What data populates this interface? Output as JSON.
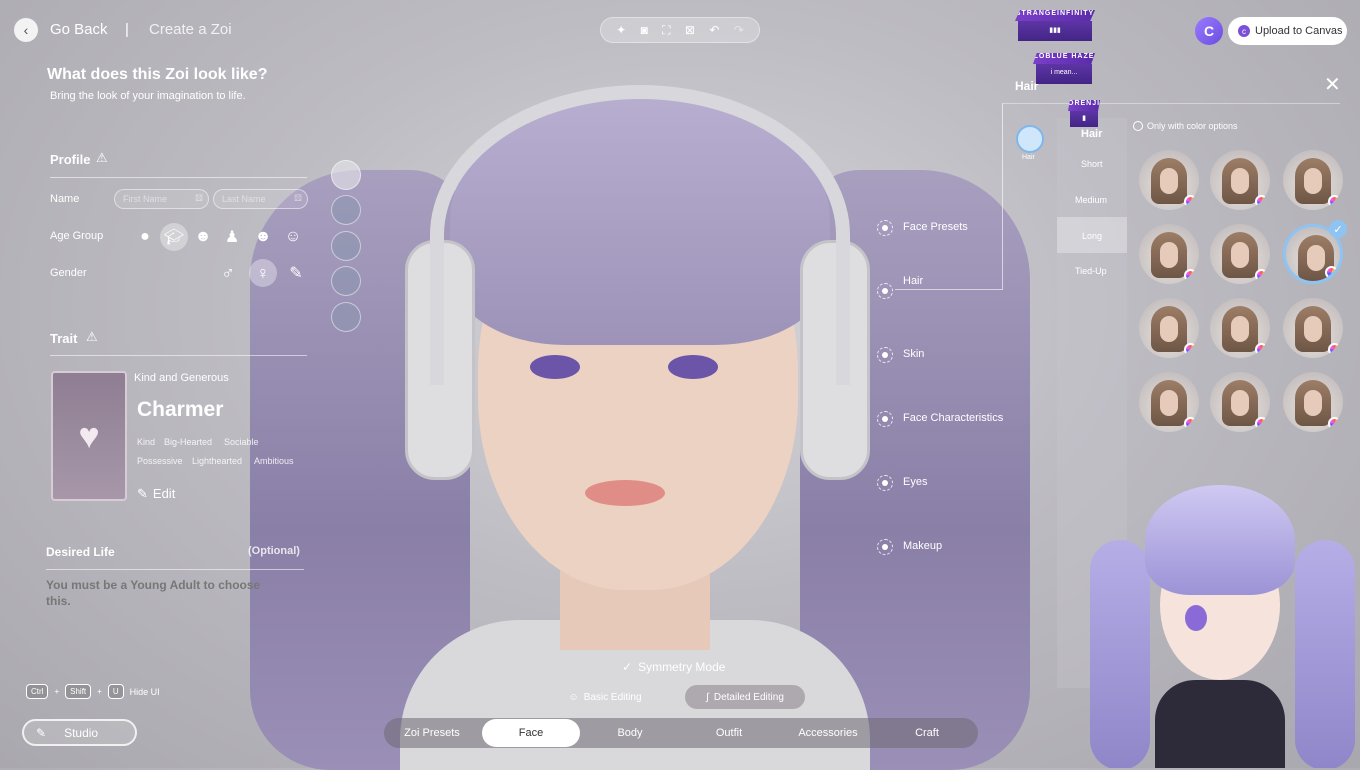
{
  "header": {
    "back_label": "Go Back",
    "separator": "|",
    "title": "Create a Zoi",
    "upload_label": "Upload to Canvas"
  },
  "intro": {
    "heading": "What does this Zoi look like?",
    "subheading": "Bring the look of your imagination to life."
  },
  "profile": {
    "title": "Profile",
    "name_label": "Name",
    "first_name_placeholder": "First Name",
    "last_name_placeholder": "Last Name",
    "age_label": "Age Group",
    "gender_label": "Gender",
    "male_symbol": "♂",
    "female_symbol": "♀"
  },
  "trait": {
    "title": "Trait",
    "subtitle": "Kind and Generous",
    "name": "Charmer",
    "tags": [
      "Kind",
      "Big-Hearted",
      "Sociable",
      "Possessive",
      "Lighthearted",
      "Ambitious"
    ],
    "edit_label": "Edit"
  },
  "desired_life": {
    "title": "Desired Life",
    "optional": "(Optional)",
    "message": "You must be a Young Adult to choose this."
  },
  "shortcut": {
    "keys": [
      "Ctrl",
      "Shift",
      "U"
    ],
    "plus": "+",
    "label": "Hide UI"
  },
  "studio_label": "Studio",
  "categories": [
    "Face Presets",
    "Hair",
    "Skin",
    "Face Characteristics",
    "Eyes",
    "Makeup"
  ],
  "symmetry_label": "Symmetry Mode",
  "edit_modes": [
    "Basic Editing",
    "Detailed Editing"
  ],
  "bottom_tabs": [
    "Zoi Presets",
    "Face",
    "Body",
    "Outfit",
    "Accessories",
    "Craft"
  ],
  "active_tab": "Face",
  "hair_panel": {
    "title": "Hair",
    "icon_label": "Hair",
    "list_title": "Hair",
    "lengths": [
      "Short",
      "Medium",
      "Long",
      "Tied-Up"
    ],
    "selected_length": "Long",
    "color_option_label": "Only with color options",
    "selected_index": 5,
    "option_count": 12
  },
  "chat": [
    {
      "user": "STRANGEINFINITY",
      "message": "▮▮▮"
    },
    {
      "user": "LOBLUE HAZE",
      "message": "i mean..."
    },
    {
      "user": "ORENJI",
      "message": "▮"
    }
  ],
  "colors": {
    "accent": "#7b4fd6",
    "hair": "#a99bc2"
  }
}
